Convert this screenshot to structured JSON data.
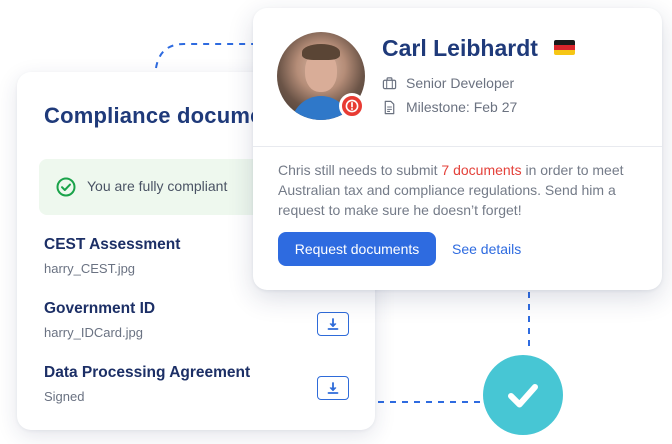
{
  "compliance": {
    "title": "Compliance documents",
    "status_banner": "You are fully compliant",
    "documents": [
      {
        "title": "CEST Assessment",
        "subtitle": "harry_CEST.jpg"
      },
      {
        "title": "Government ID",
        "subtitle": "harry_IDCard.jpg"
      },
      {
        "title": "Data Processing Agreement",
        "subtitle": "Signed"
      }
    ]
  },
  "profile": {
    "name": "Carl Leibhardt",
    "flag": "germany-flag-icon",
    "role": "Senior Developer",
    "milestone": "Milestone: Feb 27",
    "message_before": "Chris still needs to submit ",
    "message_highlight": "7 documents",
    "message_after": " in order to meet Australian tax and compliance regulations. Send him a request to make sure he doesn’t forget!",
    "primary_action": "Request documents",
    "secondary_action": "See details"
  },
  "colors": {
    "primary": "#2e6be0",
    "heading": "#1f3a7a",
    "alert": "#e83b33",
    "success": "#1aa34a",
    "check_bubble": "#47c6d4"
  }
}
